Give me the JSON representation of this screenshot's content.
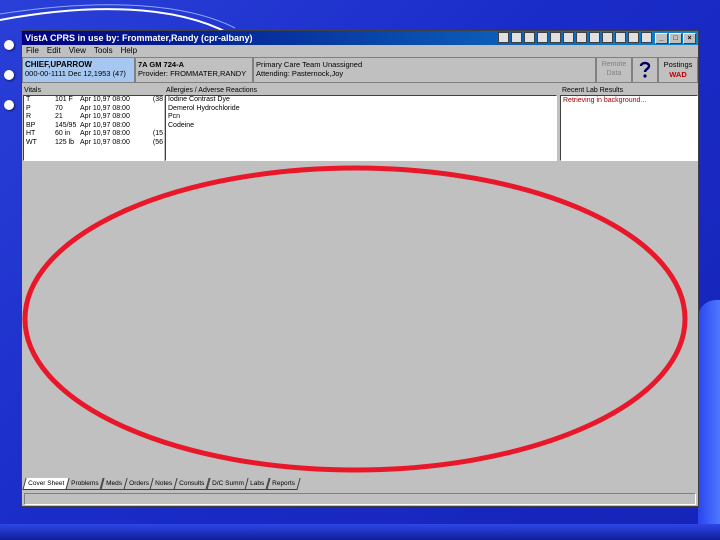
{
  "window": {
    "title": "VistA CPRS in use by: Frommater,Randy  (cpr-albany)",
    "controls": [
      "_",
      "□",
      "×"
    ]
  },
  "menu": [
    "File",
    "Edit",
    "View",
    "Tools",
    "Help"
  ],
  "patient": {
    "name": "CHIEF,UPARROW",
    "ssn_dob": "000-00-1111  Dec 12,1953 (47)"
  },
  "location": {
    "line1": "7A GM 724-A",
    "line2": "Provider: FROMMATER,RANDY"
  },
  "care_team": {
    "line1": "Primary Care Team Unassigned",
    "line2": "Attending: Pasternock,Joy"
  },
  "remote_data": {
    "line1": "Remote",
    "line2": "Data"
  },
  "postings": {
    "label": "Postings",
    "value": "WAD"
  },
  "vitals": {
    "label": "Vitals",
    "rows": [
      [
        "T",
        "101 F",
        "Apr 10,97 08:00",
        "(38"
      ],
      [
        "P",
        "70",
        "Apr 10,97 08:00",
        ""
      ],
      [
        "R",
        "21",
        "Apr 10,97 08:00",
        ""
      ],
      [
        "BP",
        "145/95",
        "Apr 10,97 08:00",
        ""
      ],
      [
        "HT",
        "60 in",
        "Apr 10,97 08:00",
        "(15"
      ],
      [
        "WT",
        "125 lb",
        "Apr 10,97 08:00",
        "(56"
      ]
    ]
  },
  "allergies": {
    "label": "Allergies / Adverse Reactions",
    "items": [
      "Iodine Contrast Dye",
      "Demerol Hydrochloride",
      "Pcn",
      "Codeine"
    ]
  },
  "labs": {
    "label": "Recent Lab Results",
    "message": "Retrieving in background..."
  },
  "tabs": [
    "Cover Sheet",
    "Problems",
    "Meds",
    "Orders",
    "Notes",
    "Consults",
    "D/C Summ",
    "Labs",
    "Reports"
  ],
  "colors": {
    "annotation": "#e8182a",
    "titlebar": "#000080",
    "patient_bg": "#a6c8f0"
  }
}
